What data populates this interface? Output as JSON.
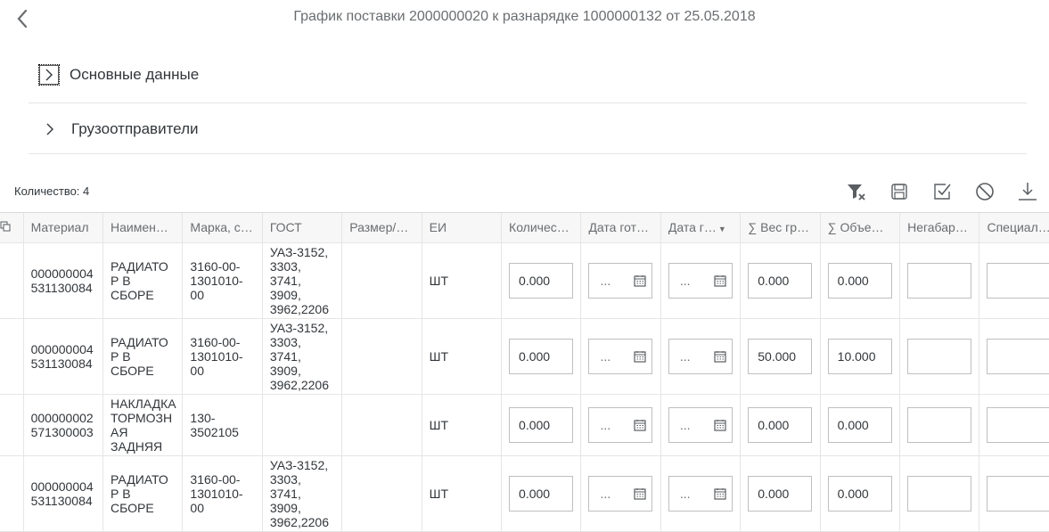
{
  "header": {
    "title": "График поставки 2000000020 к разнарядке 1000000132 от 25.05.2018"
  },
  "panels": [
    {
      "label": "Основные данные"
    },
    {
      "label": "Грузоотправители"
    }
  ],
  "table_info": {
    "count_label": "Количество: 4"
  },
  "toolbar_icons": [
    "clear-filter-icon",
    "save-icon",
    "check-icon",
    "cancel-icon",
    "download-icon"
  ],
  "columns": [
    "Материал",
    "Наимен…",
    "Марка, с…",
    "ГОСТ",
    "Размер/…",
    "ЕИ",
    "Количес…",
    "Дата гот…",
    "Дата г…",
    "∑ Вес гр…",
    "∑ Объе…",
    "Негабар…",
    "Специал…"
  ],
  "rows": [
    {
      "material": [
        "000000004",
        "531130084"
      ],
      "name": [
        "РАДИАТО",
        "Р В",
        "СБОРЕ"
      ],
      "mark": [
        "3160-00-",
        "1301010-",
        "00"
      ],
      "gost": [
        "УАЗ-3152,",
        "3303,",
        "3741,",
        "3909,",
        "3962,2206"
      ],
      "size": "",
      "unit": "ШТ",
      "qty": "0.000",
      "date1": "...",
      "date2": "...",
      "weight": "0.000",
      "volume": "0.000",
      "oversize": "",
      "special": ""
    },
    {
      "material": [
        "000000004",
        "531130084"
      ],
      "name": [
        "РАДИАТО",
        "Р В",
        "СБОРЕ"
      ],
      "mark": [
        "3160-00-",
        "1301010-",
        "00"
      ],
      "gost": [
        "УАЗ-3152,",
        "3303,",
        "3741,",
        "3909,",
        "3962,2206"
      ],
      "size": "",
      "unit": "ШТ",
      "qty": "0.000",
      "date1": "...",
      "date2": "...",
      "weight": "50.000",
      "volume": "10.000",
      "oversize": "",
      "special": ""
    },
    {
      "material": [
        "000000002",
        "571300003"
      ],
      "name": [
        "НАКЛАДКА",
        "ТОРМОЗН",
        "АЯ",
        "ЗАДНЯЯ"
      ],
      "mark": [
        "130-",
        "3502105"
      ],
      "gost": [],
      "size": "",
      "unit": "ШТ",
      "qty": "0.000",
      "date1": "...",
      "date2": "...",
      "weight": "0.000",
      "volume": "0.000",
      "oversize": "",
      "special": ""
    },
    {
      "material": [
        "000000004",
        "531130084"
      ],
      "name": [
        "РАДИАТО",
        "Р В",
        "СБОРЕ"
      ],
      "mark": [
        "3160-00-",
        "1301010-",
        "00"
      ],
      "gost": [
        "УАЗ-3152,",
        "3303,",
        "3741,",
        "3909,",
        "3962,2206"
      ],
      "size": "",
      "unit": "ШТ",
      "qty": "0.000",
      "date1": "...",
      "date2": "...",
      "weight": "0.000",
      "volume": "0.000",
      "oversize": "",
      "special": ""
    }
  ]
}
